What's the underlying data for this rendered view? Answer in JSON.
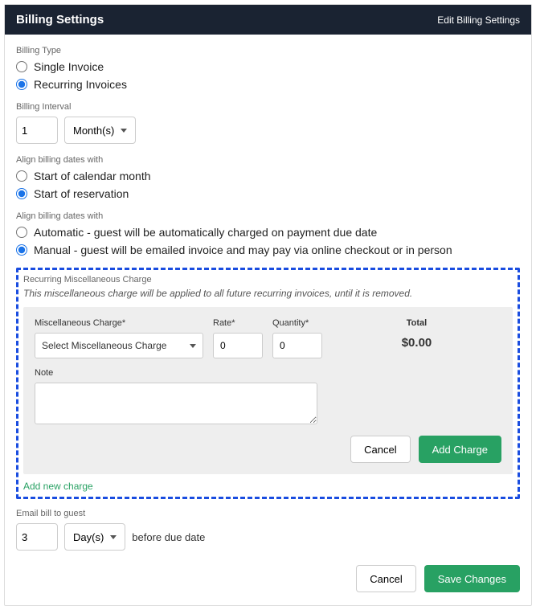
{
  "header": {
    "title": "Billing Settings",
    "edit_link": "Edit Billing Settings"
  },
  "billing_type": {
    "label": "Billing Type",
    "options": {
      "single": "Single Invoice",
      "recurring": "Recurring Invoices"
    }
  },
  "billing_interval": {
    "label": "Billing Interval",
    "value": "1",
    "unit": "Month(s)"
  },
  "align_dates": {
    "label": "Align billing dates with",
    "options": {
      "calendar": "Start of calendar month",
      "reservation": "Start of reservation"
    }
  },
  "payment_mode": {
    "label": "Align billing dates with",
    "options": {
      "automatic": "Automatic - guest will be automatically charged on payment due date",
      "manual": "Manual - guest will be emailed invoice and may pay via online checkout or in person"
    }
  },
  "recurring_charge": {
    "title": "Recurring Miscellaneous Charge",
    "note": "This miscellaneous charge will be applied to all future recurring invoices, until it is removed.",
    "fields": {
      "charge_label": "Miscellaneous Charge*",
      "charge_placeholder": "Select Miscellaneous Charge",
      "rate_label": "Rate*",
      "rate_value": "0",
      "quantity_label": "Quantity*",
      "quantity_value": "0",
      "total_label": "Total",
      "total_value": "$0.00",
      "note_label": "Note"
    },
    "buttons": {
      "cancel": "Cancel",
      "add": "Add Charge"
    },
    "add_link": "Add new charge"
  },
  "email_bill": {
    "label": "Email bill to guest",
    "value": "3",
    "unit": "Day(s)",
    "suffix": "before due date"
  },
  "footer": {
    "cancel": "Cancel",
    "save": "Save Changes"
  }
}
